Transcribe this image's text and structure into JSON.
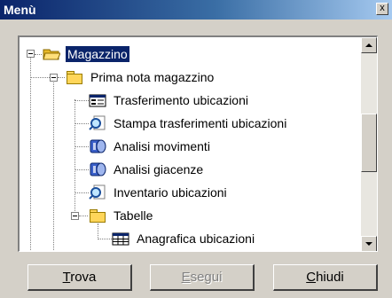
{
  "window": {
    "title": "Menù",
    "close_glyph": "x"
  },
  "tree": {
    "items": [
      {
        "label": "Magazzino",
        "icon": "open-folder-icon",
        "expanded": true,
        "selected": true
      },
      {
        "label": "Prima nota magazzino",
        "icon": "folder-icon",
        "expanded": true
      },
      {
        "label": "Trasferimento ubicazioni",
        "icon": "form-icon"
      },
      {
        "label": "Stampa trasferimenti ubicazioni",
        "icon": "search-report-icon"
      },
      {
        "label": "Analisi movimenti",
        "icon": "analysis-icon"
      },
      {
        "label": "Analisi giacenze",
        "icon": "analysis-icon"
      },
      {
        "label": "Inventario ubicazioni",
        "icon": "search-report-icon"
      },
      {
        "label": "Tabelle",
        "icon": "folder-icon",
        "expanded": true
      },
      {
        "label": "Anagrafica ubicazioni",
        "icon": "table-icon"
      }
    ]
  },
  "buttons": {
    "find": {
      "accel": "T",
      "rest": "rova",
      "enabled": true
    },
    "run": {
      "accel": "E",
      "rest": "segui",
      "enabled": false
    },
    "close": {
      "accel": "C",
      "rest": "hiudi",
      "enabled": true
    }
  }
}
